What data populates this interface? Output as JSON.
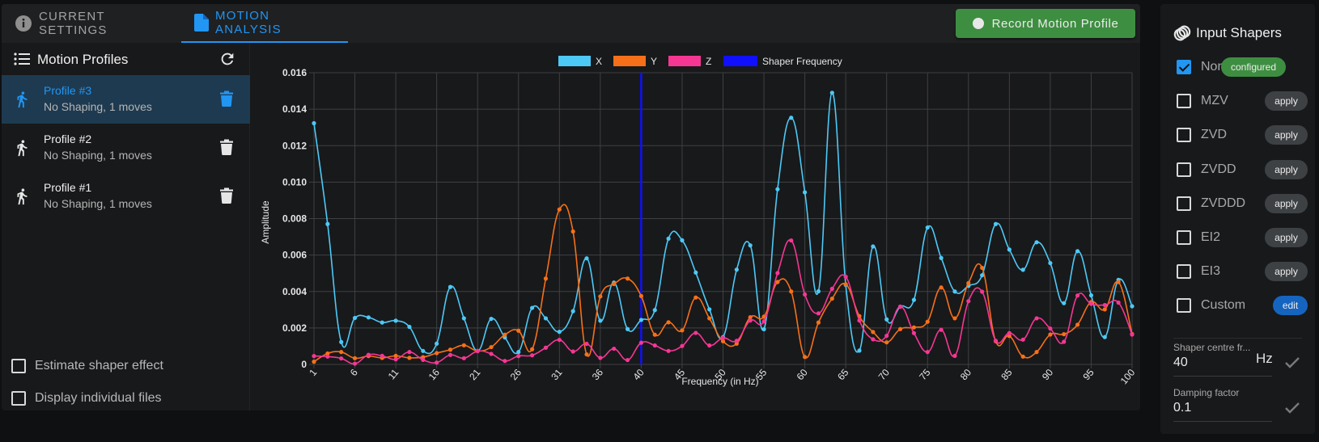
{
  "tabs": [
    {
      "label": "Current Settings",
      "icon": "info-icon",
      "active": false
    },
    {
      "label": "Motion Analysis",
      "icon": "file-icon",
      "active": true
    }
  ],
  "toolbar": {
    "record_label": "Record Motion Profile"
  },
  "profiles_panel": {
    "title": "Motion Profiles",
    "items": [
      {
        "name": "Profile #3",
        "subtitle": "No Shaping, 1 moves",
        "selected": true
      },
      {
        "name": "Profile #2",
        "subtitle": "No Shaping, 1 moves",
        "selected": false
      },
      {
        "name": "Profile #1",
        "subtitle": "No Shaping, 1 moves",
        "selected": false
      }
    ],
    "options": [
      {
        "label": "Estimate shaper effect",
        "checked": false
      },
      {
        "label": "Display individual files",
        "checked": false
      }
    ]
  },
  "input_shapers": {
    "title": "Input Shapers",
    "items": [
      {
        "name": "None",
        "checked": true,
        "action": "configured"
      },
      {
        "name": "MZV",
        "checked": false,
        "action": "apply"
      },
      {
        "name": "ZVD",
        "checked": false,
        "action": "apply"
      },
      {
        "name": "ZVDD",
        "checked": false,
        "action": "apply"
      },
      {
        "name": "ZVDDD",
        "checked": false,
        "action": "apply"
      },
      {
        "name": "EI2",
        "checked": false,
        "action": "apply"
      },
      {
        "name": "EI3",
        "checked": false,
        "action": "apply"
      },
      {
        "name": "Custom",
        "checked": false,
        "action": "edit"
      }
    ],
    "centre_freq": {
      "label": "Shaper centre fr...",
      "value": "40",
      "unit": "Hz"
    },
    "damping": {
      "label": "Damping factor",
      "value": "0.1"
    }
  },
  "colors": {
    "x": "#4dc9f6",
    "y": "#f67019",
    "z": "#f53794",
    "shaper": "#1010ff",
    "accent": "#2196f3",
    "success": "#3e8e41"
  },
  "chart_data": {
    "type": "line",
    "title": "",
    "xlabel": "Frequency (in Hz)",
    "ylabel": "Amplitude",
    "xlim": [
      1,
      100
    ],
    "ylim": [
      0,
      0.016
    ],
    "yticks": [
      "0",
      "0.002",
      "0.004",
      "0.006",
      "0.008",
      "0.010",
      "0.012",
      "0.014",
      "0.016"
    ],
    "xtick_labels": [
      "1",
      "6",
      "11",
      "16",
      "21",
      "26",
      "31",
      "36",
      "40",
      "45",
      "50",
      "55",
      "60",
      "65",
      "70",
      "75",
      "80",
      "85",
      "90",
      "95",
      "100"
    ],
    "x_start": 1,
    "x_step": 1.65,
    "point_count": 61,
    "grid": true,
    "legend": "top-center",
    "legend_entries": [
      "X",
      "Y",
      "Z",
      "Shaper Frequency"
    ],
    "shaper_frequency": 40,
    "series": [
      {
        "name": "X",
        "values": [
          0.01323,
          0.0077,
          0.00123,
          0.00255,
          0.00258,
          0.0023,
          0.0024,
          0.00206,
          0.00074,
          0.00114,
          0.00425,
          0.00253,
          0.00074,
          0.0025,
          0.00148,
          0.00068,
          0.0031,
          0.00253,
          0.00179,
          0.00292,
          0.00582,
          0.0024,
          0.00449,
          0.00194,
          0.00244,
          0.00298,
          0.0069,
          0.00681,
          0.00504,
          0.00302,
          0.0015,
          0.0052,
          0.00653,
          0.00193,
          0.00961,
          0.01353,
          0.00944,
          0.00401,
          0.0149,
          0.00436,
          0.00076,
          0.00647,
          0.00247,
          0.00317,
          0.00354,
          0.00751,
          0.00584,
          0.004,
          0.00431,
          0.00489,
          0.0077,
          0.0063,
          0.00519,
          0.0067,
          0.00556,
          0.00336,
          0.00621,
          0.00379,
          0.0015,
          0.00464,
          0.00319
        ]
      },
      {
        "name": "Y",
        "values": [
          0.00015,
          0.0006,
          0.00068,
          0.00034,
          0.00046,
          0.00036,
          0.00047,
          0.00036,
          0.0004,
          0.00062,
          0.00081,
          0.00105,
          0.00074,
          0.00095,
          0.00163,
          0.00185,
          0.00083,
          0.00471,
          0.0085,
          0.00729,
          0.00055,
          0.00373,
          0.00441,
          0.00471,
          0.00375,
          0.00163,
          0.00231,
          0.00187,
          0.00367,
          0.00253,
          0.00127,
          0.00114,
          0.00259,
          0.00262,
          0.00452,
          0.004,
          0.00041,
          0.0023,
          0.00361,
          0.0044,
          0.00265,
          0.00178,
          0.00121,
          0.00194,
          0.00203,
          0.00234,
          0.00422,
          0.00253,
          0.00446,
          0.0053,
          0.00127,
          0.00156,
          0.00043,
          0.00068,
          0.00164,
          0.00166,
          0.00218,
          0.00342,
          0.00302,
          0.00452,
          0.00167
        ]
      },
      {
        "name": "Z",
        "values": [
          0.00046,
          0.00043,
          0.00033,
          4e-05,
          0.00053,
          0.00047,
          0.00028,
          0.00068,
          0.00025,
          0.0001,
          0.00052,
          0.00034,
          0.00073,
          0.00058,
          0.00019,
          0.00046,
          0.0005,
          0.00092,
          0.00135,
          0.00071,
          0.00113,
          0.00036,
          0.00086,
          0.00024,
          0.00119,
          0.00104,
          0.00074,
          0.00101,
          0.00173,
          0.00104,
          0.00145,
          0.0013,
          0.00241,
          0.00236,
          0.00501,
          0.0068,
          0.00384,
          0.0028,
          0.00415,
          0.00481,
          0.00241,
          0.00138,
          0.00157,
          0.00317,
          0.00172,
          0.00068,
          0.0019,
          0.00047,
          0.00347,
          0.00399,
          0.0013,
          0.00172,
          0.00136,
          0.00253,
          0.00197,
          0.00124,
          0.00378,
          0.00332,
          0.00326,
          0.00339,
          0.00164
        ]
      }
    ]
  }
}
